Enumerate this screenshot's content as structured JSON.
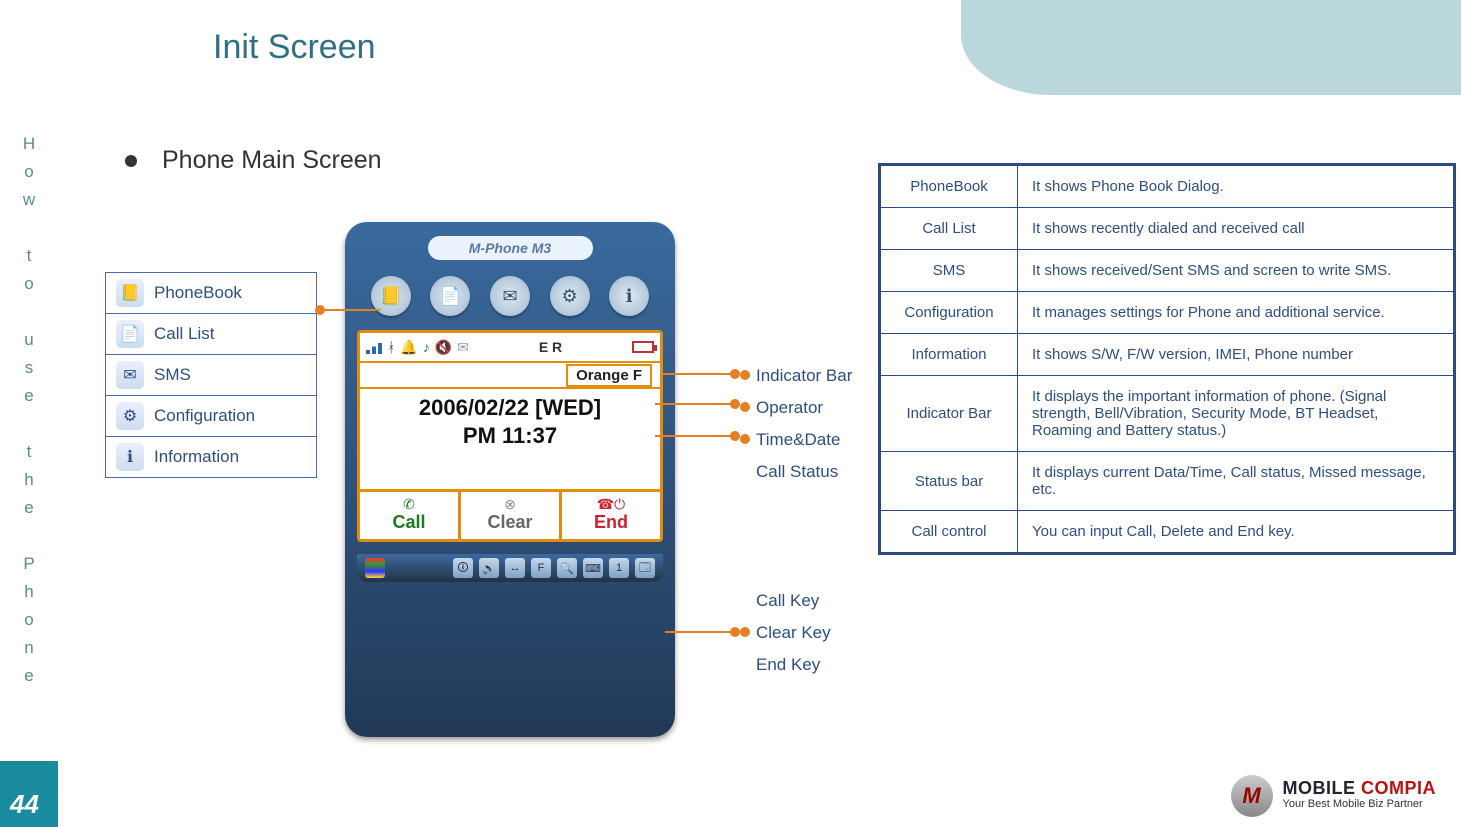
{
  "page": {
    "title": "Init Screen",
    "section": "Phone Main Screen",
    "number": "44",
    "sidebar_vertical": "How to use the Phone"
  },
  "phone": {
    "device_label": "M-Phone M3",
    "indicator_text": "E R",
    "operator": "Orange F",
    "date": "2006/02/22 [WED]",
    "time": "PM 11:37",
    "keys": {
      "call": "Call",
      "clear": "Clear",
      "end": "End"
    }
  },
  "menu_items": [
    {
      "label": "PhoneBook",
      "glyph": "📒"
    },
    {
      "label": "Call List",
      "glyph": "📄"
    },
    {
      "label": "SMS",
      "glyph": "✉"
    },
    {
      "label": "Configuration",
      "glyph": "⚙"
    },
    {
      "label": "Information",
      "glyph": "ℹ"
    }
  ],
  "callouts": {
    "indicator": "Indicator Bar",
    "operator": "Operator",
    "timedate": "Time&Date",
    "callstatus": "Call Status",
    "callkey": "Call Key",
    "clearkey": "Clear Key",
    "endkey": "End Key"
  },
  "descriptions": [
    {
      "k": "PhoneBook",
      "v": "It shows Phone Book Dialog."
    },
    {
      "k": "Call List",
      "v": "It shows recently dialed and received call"
    },
    {
      "k": "SMS",
      "v": "It shows received/Sent SMS and screen to write SMS."
    },
    {
      "k": "Configuration",
      "v": "It manages settings for Phone and additional service."
    },
    {
      "k": "Information",
      "v": "It shows S/W, F/W version, IMEI, Phone number"
    },
    {
      "k": "Indicator Bar",
      "v": "It displays the important information of phone. (Signal strength, Bell/Vibration, Security Mode, BT Headset, Roaming and Battery status.)"
    },
    {
      "k": "Status bar",
      "v": "It displays current Data/Time, Call status, Missed message, etc."
    },
    {
      "k": "Call control",
      "v": "You can input Call, Delete and End key."
    }
  ],
  "logo": {
    "brand_a": "MOBILE ",
    "brand_b": "COMPIA",
    "tagline": "Your Best Mobile Biz Partner"
  }
}
